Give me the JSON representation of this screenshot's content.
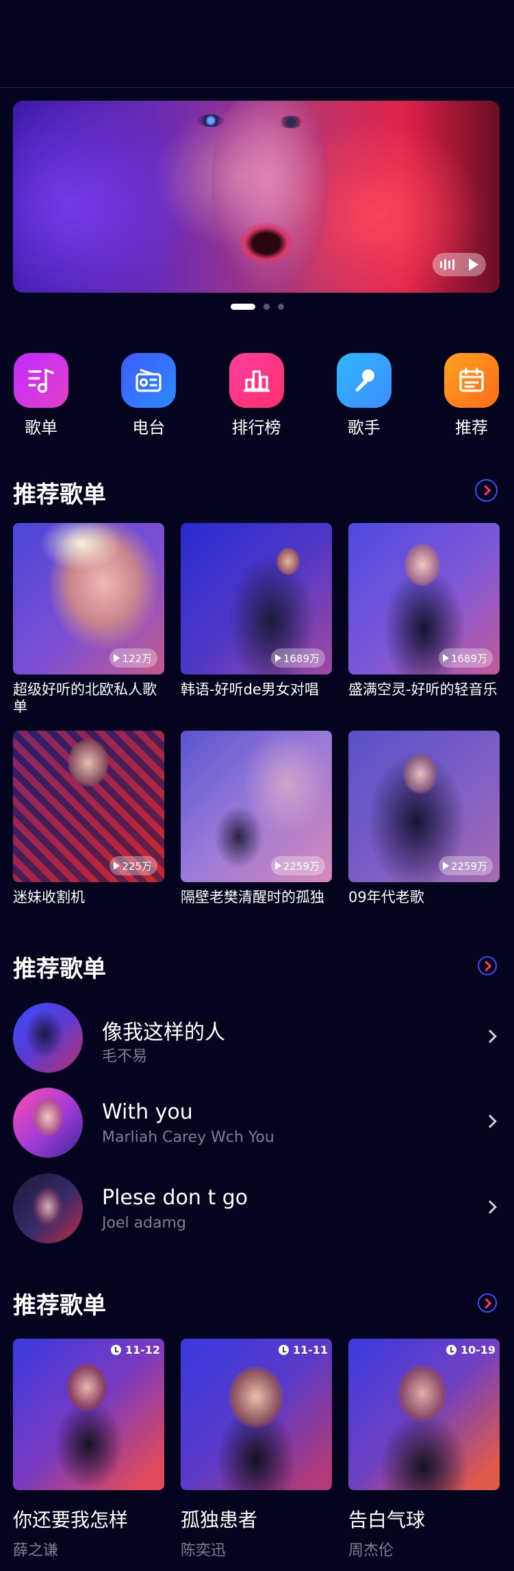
{
  "banner": {
    "dots": 3,
    "active_dot": 0
  },
  "categories": [
    {
      "label": "歌单",
      "icon": "music-note-icon",
      "color_from": "#c12bff",
      "color_to": "#e33fc8"
    },
    {
      "label": "电台",
      "icon": "radio-icon",
      "color_from": "#3f5bff",
      "color_to": "#2a8bff"
    },
    {
      "label": "排行榜",
      "icon": "chart-bars-icon",
      "color_from": "#ff3fa0",
      "color_to": "#ff2f6b"
    },
    {
      "label": "歌手",
      "icon": "microphone-icon",
      "color_from": "#2fb8ff",
      "color_to": "#3f8cff"
    },
    {
      "label": "推荐",
      "icon": "calendar-icon",
      "color_from": "#ffa21f",
      "color_to": "#ff6a1a"
    }
  ],
  "section_playlists": {
    "title": "推荐歌单",
    "items": [
      {
        "title": "超级好听的北欧私人歌单",
        "count": "122万"
      },
      {
        "title": "韩语-好听de男女对唱",
        "count": "1689万"
      },
      {
        "title": "盛满空灵-好听的轻音乐",
        "count": "1689万"
      },
      {
        "title": "迷妹收割机",
        "count": "225万"
      },
      {
        "title": "隔壁老樊清醒时的孤独",
        "count": "2259万"
      },
      {
        "title": "09年代老歌",
        "count": "2259万"
      }
    ]
  },
  "section_songs": {
    "title": "推荐歌单",
    "items": [
      {
        "title": "像我这样的人",
        "artist": "毛不易"
      },
      {
        "title": "With you",
        "artist": "Marliah Carey Wch You"
      },
      {
        "title": "Plese don t go",
        "artist": "Joel adamg"
      }
    ]
  },
  "section_releases": {
    "title": "推荐歌单",
    "items": [
      {
        "title": "你还要我怎样",
        "artist": "薛之谦",
        "date": "11-12"
      },
      {
        "title": "孤独患者",
        "artist": "陈奕迅",
        "date": "11-11"
      },
      {
        "title": "告白气球",
        "artist": "周杰伦",
        "date": "10-19"
      }
    ]
  },
  "colors": {
    "background": "#04041f",
    "accent_blue": "#3d4dff",
    "accent_red": "#ff3b5c"
  }
}
